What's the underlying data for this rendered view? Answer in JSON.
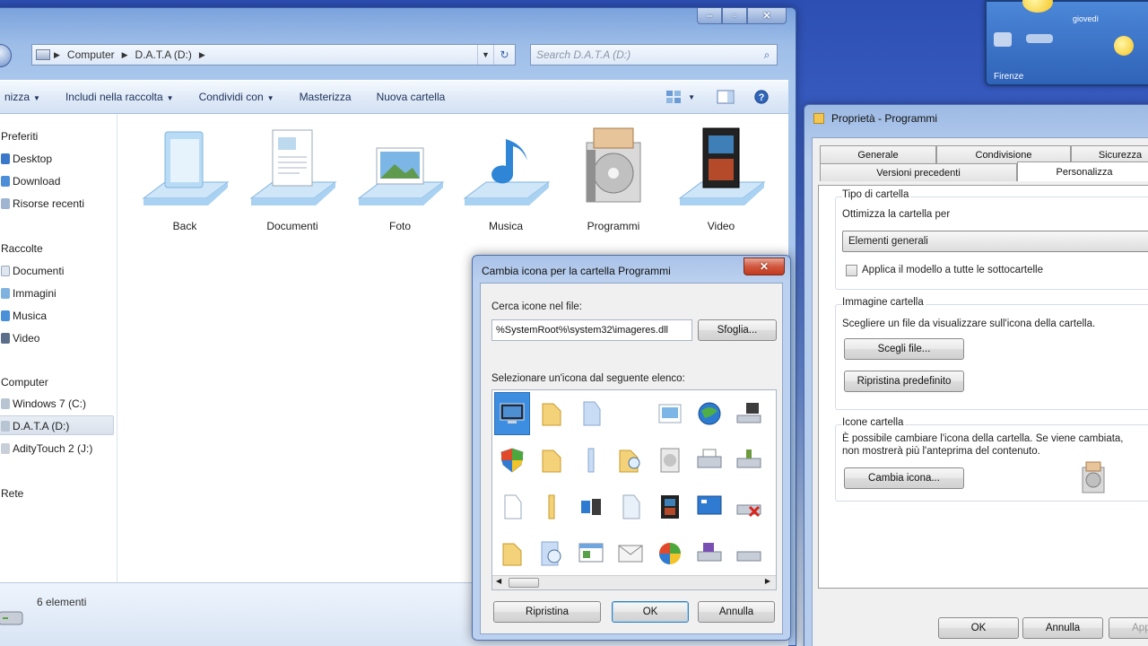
{
  "explorer": {
    "breadcrumb": [
      "Computer",
      "D.A.T.A (D:)"
    ],
    "search_placeholder": "Search D.A.T.A (D:)",
    "toolbar": {
      "organize": "nizza",
      "include": "Includi nella raccolta",
      "share": "Condividi con",
      "burn": "Masterizza",
      "new_folder": "Nuova cartella"
    },
    "sidebar": {
      "favorites_head": "Preferiti",
      "favorites": [
        "Desktop",
        "Download",
        "Risorse recenti"
      ],
      "libraries_head": "Raccolte",
      "libraries": [
        "Documenti",
        "Immagini",
        "Musica",
        "Video"
      ],
      "computer_head": "Computer",
      "drives": [
        "Windows 7 (C:)",
        "D.A.T.A (D:)",
        "AdityTouch 2 (J:)"
      ],
      "network_head": "Rete"
    },
    "folders": [
      "Back",
      "Documenti",
      "Foto",
      "Musica",
      "Programmi",
      "Video"
    ],
    "status": "6 elementi"
  },
  "properties": {
    "title": "Proprietà - Programmi",
    "tabs_row1": [
      "Generale",
      "Condivisione",
      "Sicurezza"
    ],
    "tabs_row2": [
      "Versioni precedenti",
      "Personalizza"
    ],
    "folder_type_group": "Tipo di cartella",
    "optimize_label": "Ottimizza la cartella per",
    "optimize_value": "Elementi generali",
    "apply_subfolders": "Applica il modello a tutte le sottocartelle",
    "folder_image_group": "Immagine cartella",
    "folder_image_text": "Scegliere un file da visualizzare sull'icona della cartella.",
    "choose_file": "Scegli file...",
    "restore_default": "Ripristina predefinito",
    "folder_icon_group": "Icone cartella",
    "folder_icon_text1": "È possibile cambiare l'icona della cartella. Se viene cambiata,",
    "folder_icon_text2": "non mostrerà più l'anteprima del contenuto.",
    "change_icon": "Cambia icona...",
    "ok": "OK",
    "cancel": "Annulla",
    "apply": "Applica"
  },
  "dialog": {
    "title": "Cambia icona per la cartella Programmi",
    "search_label": "Cerca icone nel file:",
    "path_value": "%SystemRoot%\\system32\\imageres.dll",
    "browse": "Sfoglia...",
    "list_label": "Selezionare un'icona dal seguente elenco:",
    "restore": "Ripristina",
    "ok": "OK",
    "cancel": "Annulla"
  },
  "gadget": {
    "day": "giovedì",
    "location": "Firenze"
  }
}
